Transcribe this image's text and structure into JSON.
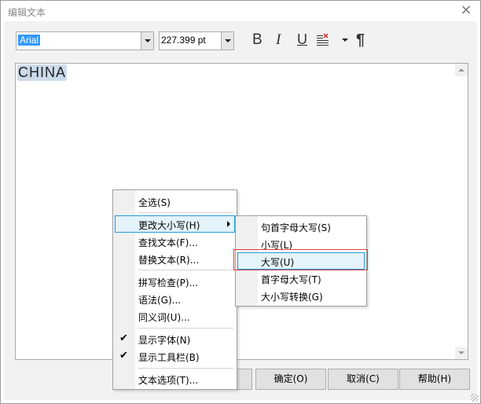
{
  "window": {
    "title": "编辑文本",
    "close_icon": "×"
  },
  "toolbar": {
    "font_name": "Arial",
    "font_size": "227.399 pt",
    "bold": "B",
    "italic": "I",
    "underline": "U",
    "paragraph": "¶"
  },
  "editor": {
    "text": "CHINA"
  },
  "context_menu": {
    "items": [
      {
        "label": "全选(S)",
        "checked": false,
        "submenu": false
      },
      {
        "label": "更改大小写(H)",
        "checked": false,
        "submenu": true,
        "highlighted": true
      },
      {
        "label": "查找文本(F)...",
        "checked": false,
        "submenu": false
      },
      {
        "label": "替换文本(R)...",
        "checked": false,
        "submenu": false
      },
      {
        "label": "拼写检查(P)...",
        "checked": false,
        "submenu": false
      },
      {
        "label": "语法(G)...",
        "checked": false,
        "submenu": false
      },
      {
        "label": "同义词(U)...",
        "checked": false,
        "submenu": false
      },
      {
        "label": "显示字体(N)",
        "checked": true,
        "submenu": false
      },
      {
        "label": "显示工具栏(B)",
        "checked": true,
        "submenu": false
      },
      {
        "label": "文本选项(T)...",
        "checked": false,
        "submenu": false
      }
    ]
  },
  "submenu": {
    "items": [
      {
        "label": "句首字母大写(S)"
      },
      {
        "label": "小写(L)"
      },
      {
        "label": "大写(U)",
        "highlighted": true
      },
      {
        "label": "首字母大写(T)"
      },
      {
        "label": "大小写转换(G)"
      }
    ]
  },
  "buttons": {
    "ok": "确定(O)",
    "cancel": "取消(C)",
    "help": "帮助(H)"
  },
  "colors": {
    "selection": "#3399ff",
    "menu_highlight_bg": "#e5f3fb",
    "menu_highlight_border": "#1e9be0",
    "annotation_red": "#e04040"
  }
}
